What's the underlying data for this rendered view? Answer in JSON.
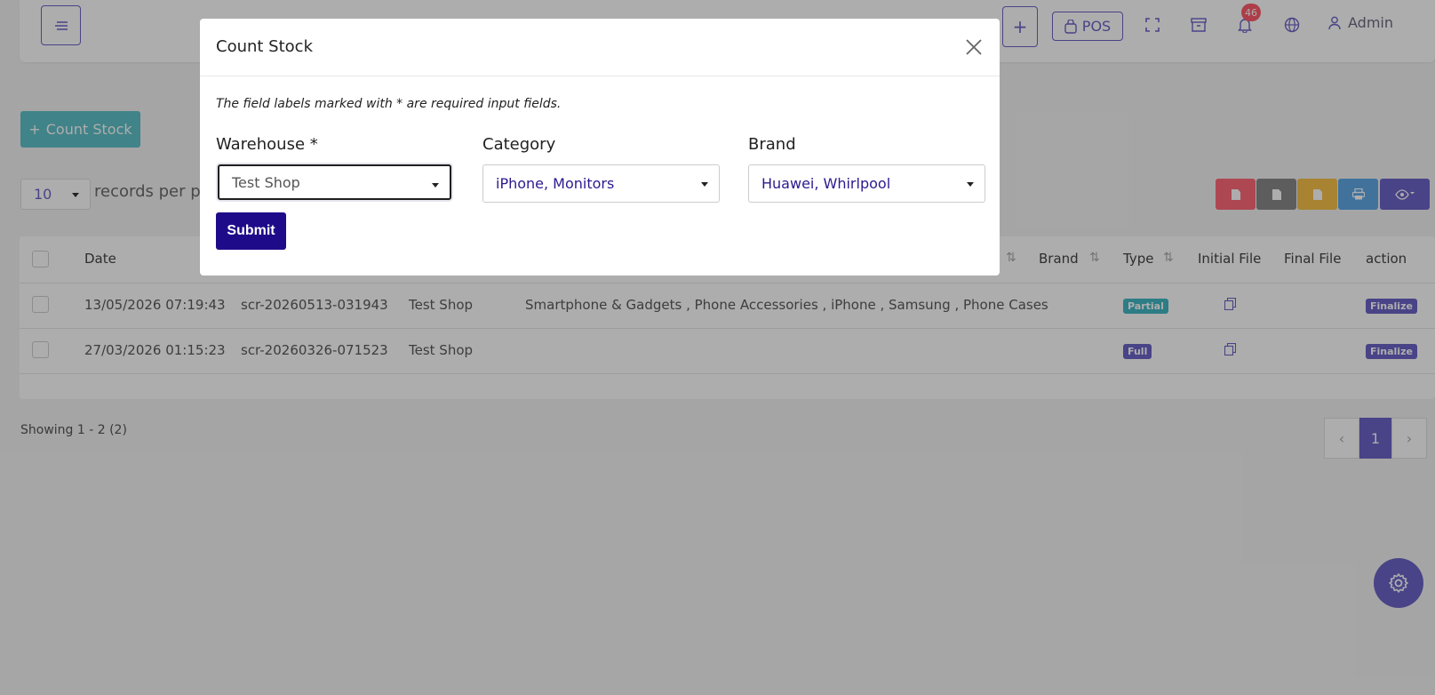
{
  "topbar": {
    "pos_label": "POS",
    "notification_count": "46",
    "user_name": "Admin"
  },
  "page": {
    "add_button_label": "Count Stock",
    "per_page_value": "10",
    "per_page_label": "records per page"
  },
  "table": {
    "columns": [
      "Date",
      "Brand",
      "Type",
      "Initial File",
      "Final File",
      "action"
    ],
    "rows": [
      {
        "date": "13/05/2026 07:19:43",
        "reference": "scr-20260513-031943",
        "warehouse": "Test Shop",
        "category": "Smartphone & Gadgets , Phone Accessories , iPhone , Samsung , Phone Cases",
        "type": "Partial",
        "action": "Finalize"
      },
      {
        "date": "27/03/2026 01:15:23",
        "reference": "scr-20260326-071523",
        "warehouse": "Test Shop",
        "category": "",
        "type": "Full",
        "action": "Finalize"
      }
    ]
  },
  "pagination": {
    "showing": "Showing 1 - 2 (2)",
    "current_page": "1",
    "prev": "‹",
    "next": "›"
  },
  "modal": {
    "title": "Count Stock",
    "note": "The field labels marked with * are required input fields.",
    "warehouse_label": "Warehouse *",
    "warehouse_value": "Test Shop",
    "category_label": "Category",
    "category_value": "iPhone, Monitors",
    "brand_label": "Brand",
    "brand_value": "Huawei, Whirlpool",
    "submit_label": "Submit"
  },
  "colors": {
    "primary": "#6c63c8",
    "submit": "#1e0b8a",
    "teal": "#5fc1c9",
    "pdf": "#ff6b7a",
    "csv": "#8a8a8a",
    "excel": "#f7c24a",
    "print": "#5fa9e6"
  },
  "icons": [
    "menu-icon",
    "plus-icon",
    "bag-icon",
    "fullscreen-icon",
    "archive-icon",
    "bell-icon",
    "globe-icon",
    "user-icon",
    "close-icon",
    "pdf-icon",
    "csv-icon",
    "excel-icon",
    "print-icon",
    "eye-icon",
    "gear-icon",
    "file-icon"
  ]
}
